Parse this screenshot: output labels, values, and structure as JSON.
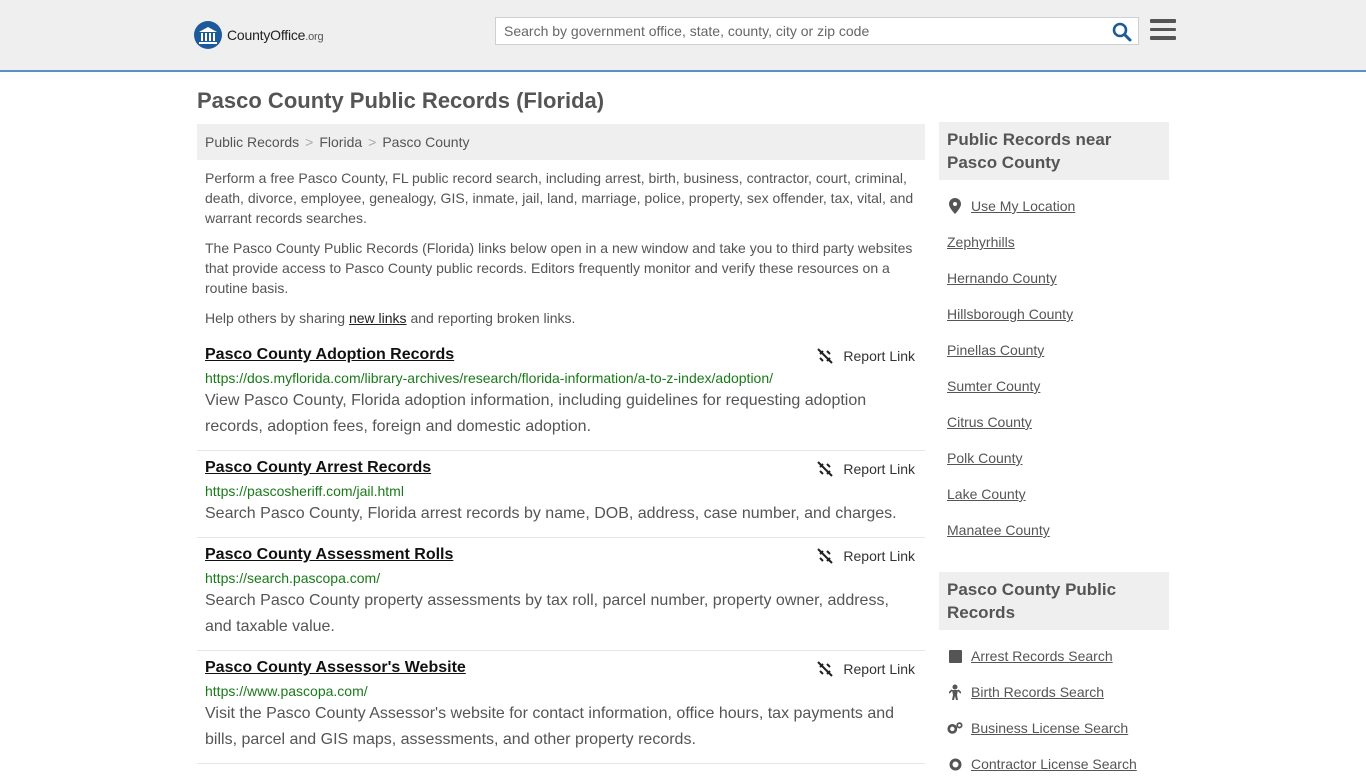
{
  "header": {
    "logo_text_main": "CountyOffice",
    "logo_text_suffix": ".org",
    "search_placeholder": "Search by government office, state, county, city or zip code"
  },
  "page_title": "Pasco County Public Records (Florida)",
  "breadcrumb": [
    "Public Records",
    "Florida",
    "Pasco County"
  ],
  "intro": {
    "p1": "Perform a free Pasco County, FL public record search, including arrest, birth, business, contractor, court, criminal, death, divorce, employee, genealogy, GIS, inmate, jail, land, marriage, police, property, sex offender, tax, vital, and warrant records searches.",
    "p2": "The Pasco County Public Records (Florida) links below open in a new window and take you to third party websites that provide access to Pasco County public records. Editors frequently monitor and verify these resources on a routine basis.",
    "p3_before": "Help others by sharing ",
    "p3_link": "new links",
    "p3_after": " and reporting broken links."
  },
  "report_label": "Report Link",
  "records": [
    {
      "title": "Pasco County Adoption Records",
      "url": "https://dos.myflorida.com/library-archives/research/florida-information/a-to-z-index/adoption/",
      "desc": "View Pasco County, Florida adoption information, including guidelines for requesting adoption records, adoption fees, foreign and domestic adoption."
    },
    {
      "title": "Pasco County Arrest Records",
      "url": "https://pascosheriff.com/jail.html",
      "desc": "Search Pasco County, Florida arrest records by name, DOB, address, case number, and charges."
    },
    {
      "title": "Pasco County Assessment Rolls",
      "url": "https://search.pascopa.com/",
      "desc": "Search Pasco County property assessments by tax roll, parcel number, property owner, address, and taxable value."
    },
    {
      "title": "Pasco County Assessor's Website",
      "url": "https://www.pascopa.com/",
      "desc": "Visit the Pasco County Assessor's website for contact information, office hours, tax payments and bills, parcel and GIS maps, assessments, and other property records."
    }
  ],
  "sidebar": {
    "near_title": "Public Records near Pasco County",
    "use_location": "Use My Location",
    "near_items": [
      "Zephyrhills",
      "Hernando County",
      "Hillsborough County",
      "Pinellas County",
      "Sumter County",
      "Citrus County",
      "Polk County",
      "Lake County",
      "Manatee County"
    ],
    "records_title": "Pasco County Public Records",
    "record_links": [
      {
        "label": "Arrest Records Search",
        "icon": "square-icon"
      },
      {
        "label": "Birth Records Search",
        "icon": "baby-icon"
      },
      {
        "label": "Business License Search",
        "icon": "gears-icon"
      },
      {
        "label": "Contractor License Search",
        "icon": "gear-icon"
      }
    ]
  },
  "colors": {
    "accent": "#5b8fc7",
    "url_green": "#1a7a1a",
    "logo_blue": "#1d5a99"
  }
}
